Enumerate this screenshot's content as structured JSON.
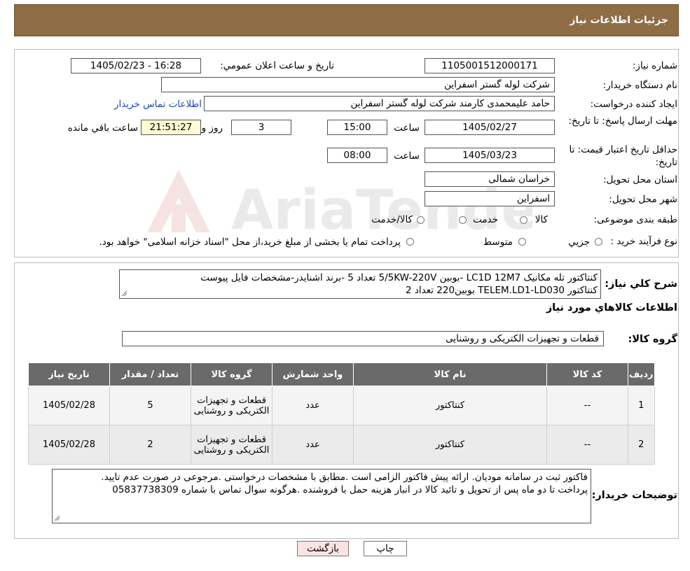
{
  "header": {
    "title": "جزئیات اطلاعات نیاز"
  },
  "form": {
    "need_number_label": "شماره نیاز:",
    "need_number": "1105001512000171",
    "announce_label": "تاریخ و ساعت اعلان عمومي:",
    "announce_value": "1405/02/23 - 16:28",
    "buyer_org_label": "نام دستگاه خريدار:",
    "buyer_org": "شركت لوله گستر اسفراين",
    "creator_label": "ايجاد كننده درخواست:",
    "creator": "حامد عليمحمدی كارمند شركت لوله گستر اسفراين",
    "contact_link": "اطلاعات تماس خريدار",
    "reply_deadline_label": "مهلت ارسال پاسخ: تا تاريخ:",
    "reply_date": "1405/02/27",
    "time_label": "ساعت",
    "reply_time": "15:00",
    "days_value": "3",
    "days_label": "روز و",
    "remaining_time": "21:51:27",
    "remaining_label": "ساعت باقي مانده",
    "min_validity_label": "حداقل تاريخ اعتبار قيمت: تا تاريخ:",
    "validity_date": "1405/03/23",
    "validity_time": "08:00",
    "province_label": "استان محل تحويل:",
    "province": "خراسان شمالی",
    "city_label": "شهر محل تحويل:",
    "city": "اسفراين",
    "category_label": "طبقه بندی موضوعی:",
    "category_options": [
      "كالا",
      "خدمت",
      "كالا/خدمت"
    ],
    "process_label": "نوع فرآیند خرید :",
    "process_options": [
      "جزيي",
      "متوسط"
    ],
    "process_note": "پرداخت تمام یا بخشی از مبلغ خرید،از محل \"اسناد خزانه اسلامی\" خواهد بود."
  },
  "description": {
    "label": "شرح كلي نياز:",
    "text": "كنتاكتور تله مكانيک LC1D 12M7 -بوبين 5/5KW-220V  تعداد 5 -برند اشنايدر-مشخصات فايل پيوست\nكنتاكتور TELEM.LD1-LD030 بوبين220 تعداد 2"
  },
  "goods_info_title": "اطلاعات كالاهاي مورد نياز",
  "goods_group_label": "گروه كالا:",
  "goods_group": "قطعات و تجهيزات الكتريكی و روشنايی",
  "table": {
    "headers": [
      "رديف",
      "كد كالا",
      "نام كالا",
      "واحد شمارش",
      "گروه كالا",
      "تعداد / مقدار",
      "تاريخ نياز"
    ],
    "rows": [
      [
        "1",
        "--",
        "كنتاكتور",
        "عدد",
        "قطعات و تجهيزات الكتريكی و روشنايی",
        "5",
        "1405/02/28"
      ],
      [
        "2",
        "--",
        "كنتاكتور",
        "عدد",
        "قطعات و تجهيزات الكتريكی و روشنايی",
        "2",
        "1405/02/28"
      ]
    ]
  },
  "buyer_notes": {
    "label": "توضيحات خريدار:",
    "text": "فاكتور ثبت در سامانه موديان. ارائه پيش فاكتور الزامی است .مطابق با مشخصات درخواستی .مرجوعی در صورت عدم تاييد.\nپرداخت تا دو ماه پس از تحويل و تائيد كالا در انبار  هزينه حمل با فروشنده .هرگونه سوال تماس با شماره 05837738309"
  },
  "buttons": {
    "print": "چاپ",
    "back": "بازگشت"
  },
  "watermark": {
    "text": "AriaTender.neT"
  },
  "colors": {
    "header_bg": "#8f6d45",
    "table_header_bg": "#6a6a6a",
    "back_button_bg": "#fbe3e3",
    "timer_bg": "#fffbd4",
    "link": "#2046c0"
  }
}
